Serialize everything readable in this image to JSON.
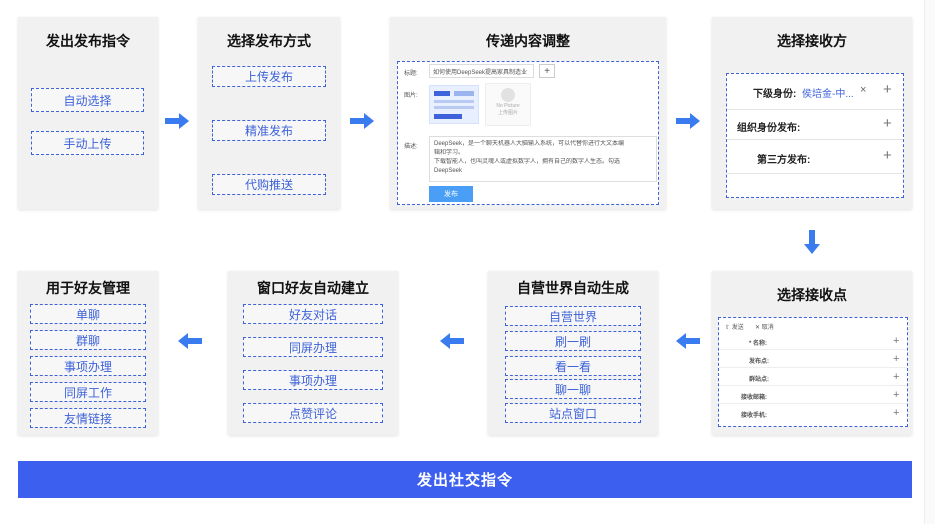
{
  "steps": {
    "s1": {
      "title": "发出发布指令",
      "items": [
        "自动选择",
        "手动上传"
      ]
    },
    "s2": {
      "title": "选择发布方式",
      "items": [
        "上传发布",
        "精准发布",
        "代购推送"
      ]
    },
    "s3": {
      "title": "传递内容调整",
      "label_title": "标题:",
      "title_value": "如何使用DeepSeek提高家具制造业",
      "add": "+",
      "label_image": "图片:",
      "placeholder_line1": "No Picture",
      "placeholder_line2": "上传图片",
      "label_desc": "描述:",
      "desc_lines": [
        "DeepSeek，是一个聊天机器人大脑输入系统，可以代替你进行大文本编",
        "辑和学习。",
        "下载智能人，也叫灵魂人或虚拟数字人，拥有自己的数字人生态。勾选",
        "DeepSeek"
      ],
      "submit": "发布"
    },
    "s4": {
      "title": "选择接收方",
      "rows": [
        {
          "label": "下级身份:",
          "value": "侯培金-中...",
          "close": "×",
          "plus": "+"
        },
        {
          "label": "组织身份发布:",
          "plus": "+"
        },
        {
          "label": "第三方发布:",
          "plus": "+"
        }
      ]
    },
    "s5": {
      "title": "选择接收点",
      "send": "发送",
      "cancel": "取消",
      "rows": [
        {
          "label": "* 名称:",
          "plus": "+"
        },
        {
          "label": "发布点:",
          "plus": "+"
        },
        {
          "label": "群站点:",
          "plus": "+"
        },
        {
          "label": "接收邮箱:",
          "plus": "+"
        },
        {
          "label": "接收手机:",
          "plus": "+"
        }
      ]
    },
    "s6": {
      "title": "自营世界自动生成",
      "items": [
        "自营世界",
        "刷一刷",
        "看一看",
        "聊一聊",
        "站点窗口"
      ]
    },
    "s7": {
      "title": "窗口好友自动建立",
      "items": [
        "好友对话",
        "同屏办理",
        "事项办理",
        "点赞评论"
      ]
    },
    "s8": {
      "title": "用于好友管理",
      "items": [
        "单聊",
        "群聊",
        "事项办理",
        "同屏工作",
        "友情链接"
      ]
    }
  },
  "bottom": {
    "label": "发出社交指令"
  },
  "colors": {
    "accent": "#3d62d9",
    "bar": "#3d5ff0",
    "arrow": "#3a7cf0",
    "card": "#f1f1f1"
  }
}
